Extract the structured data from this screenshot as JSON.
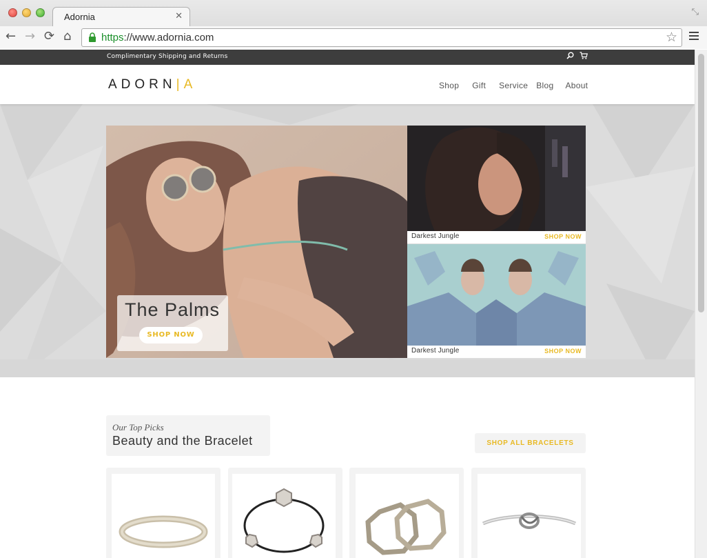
{
  "browser": {
    "tab_title": "Adornia",
    "url_scheme": "https",
    "url_rest": "://www.adornia.com"
  },
  "topbar": {
    "promo": "Complimentary Shipping and Returns",
    "icons": [
      "search-icon",
      "cart-icon"
    ]
  },
  "header": {
    "logo_main": "ADORN",
    "logo_sep": "|",
    "logo_end": "A",
    "nav": [
      "Shop",
      "Gift",
      "Service",
      "Blog",
      "About"
    ]
  },
  "hero": {
    "main": {
      "title": "The Palms",
      "cta": "SHOP NOW"
    },
    "side": [
      {
        "name": "Darkest Jungle",
        "cta": "SHOP NOW"
      },
      {
        "name": "Darkest Jungle",
        "cta": "SHOP NOW"
      }
    ]
  },
  "top_picks": {
    "kicker": "Our Top Picks",
    "title": "Beauty and the Bracelet",
    "cta": "SHOP ALL BRACELETS"
  },
  "products": [
    "hammered-bangle",
    "hexagon-bangle",
    "octagon-bangle-pair",
    "knot-cuff"
  ],
  "colors": {
    "accent": "#e8b923",
    "topbar": "#3d3d3d",
    "hero_bg": "#dcdcdc"
  }
}
